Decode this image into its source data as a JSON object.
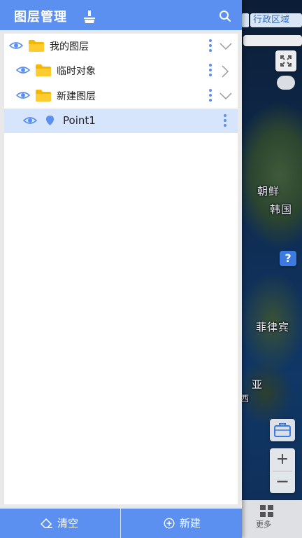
{
  "header": {
    "title": "图层管理"
  },
  "map": {
    "region_tag": "行政区域",
    "labels": [
      "朝鲜",
      "韩国",
      "菲律宾",
      "亚",
      "西"
    ],
    "more_label": "更多"
  },
  "tree": {
    "items": [
      {
        "label": "我的图层",
        "type": "folder",
        "expanded": true
      },
      {
        "label": "临时对象",
        "type": "folder",
        "expanded": false
      },
      {
        "label": "新建图层",
        "type": "folder",
        "expanded": true
      },
      {
        "label": "Point1",
        "type": "point",
        "selected": true
      }
    ]
  },
  "footer": {
    "clear_label": "清空",
    "new_label": "新建"
  },
  "colors": {
    "accent": "#5b8ff0",
    "folder": "#f5b800",
    "selected_row": "#d6e4fc"
  }
}
